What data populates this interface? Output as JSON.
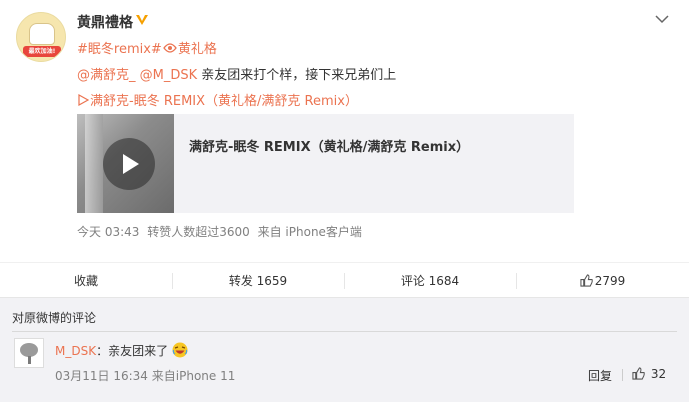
{
  "post": {
    "username": "黄鼎禮格",
    "avatar_badge": "最欢加油!",
    "topics": [
      {
        "text": "#眠冬remix#"
      },
      {
        "text": "黄礼格"
      }
    ],
    "mentions": [
      "@满舒克_",
      "@M_DSK"
    ],
    "body_text": " 亲友团来打个样，接下来兄弟们上",
    "video_link": "眠冬 REMIX（黄礼格/满舒克 Remix）",
    "video_link_prefix": "满舒克-",
    "card_title": "满舒克-眠冬 REMIX（黄礼格/满舒克 Remix）",
    "meta_time": "今天 03:43",
    "meta_reposts": "转赞人数超过3600",
    "meta_source": "来自 iPhone客户端"
  },
  "actions": {
    "favorite": "收藏",
    "repost": "转发 1659",
    "comment": "评论 1684",
    "like": "2799"
  },
  "comments": {
    "header": "对原微博的评论",
    "items": [
      {
        "user": "M_DSK",
        "separator": "：",
        "text": "亲友团来了",
        "time": "03月11日 16:34",
        "source": "来自iPhone 11",
        "reply": "回复",
        "likes": "32"
      }
    ]
  },
  "colors": {
    "accent": "#eb7350",
    "vip_badge": "#f6a000",
    "topic_blue": "#eb7350"
  }
}
